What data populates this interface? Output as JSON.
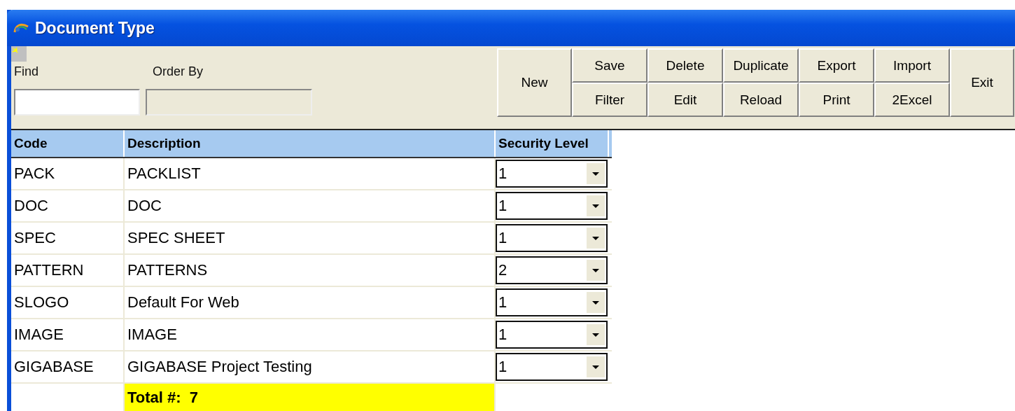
{
  "window": {
    "title": "Document Type"
  },
  "filters": {
    "find_label": "Find",
    "order_label": "Order By"
  },
  "toolbar": [
    {
      "kind": "single",
      "labels": [
        "New"
      ]
    },
    {
      "kind": "pair",
      "labels": [
        "Save",
        "Filter"
      ]
    },
    {
      "kind": "pair",
      "labels": [
        "Delete",
        "Edit"
      ]
    },
    {
      "kind": "pair",
      "labels": [
        "Duplicate",
        "Reload"
      ]
    },
    {
      "kind": "pair",
      "labels": [
        "Export",
        "Print"
      ]
    },
    {
      "kind": "pair",
      "labels": [
        "Import",
        "2Excel"
      ]
    },
    {
      "kind": "single",
      "labels": [
        "Exit"
      ]
    }
  ],
  "table": {
    "columns": [
      "Code",
      "Description",
      "Security Level"
    ],
    "rows": [
      {
        "code": "PACK",
        "description": "PACKLIST",
        "security_level": "1"
      },
      {
        "code": "DOC",
        "description": "DOC",
        "security_level": "1"
      },
      {
        "code": "SPEC",
        "description": "SPEC SHEET",
        "security_level": "1"
      },
      {
        "code": "PATTERN",
        "description": "PATTERNS",
        "security_level": "2"
      },
      {
        "code": "SLOGO",
        "description": "Default For Web",
        "security_level": "1"
      },
      {
        "code": "IMAGE",
        "description": "IMAGE",
        "security_level": "1"
      },
      {
        "code": "GIGABASE",
        "description": "GIGABASE Project Testing",
        "security_level": "1"
      }
    ],
    "total": "Total #:  7"
  }
}
